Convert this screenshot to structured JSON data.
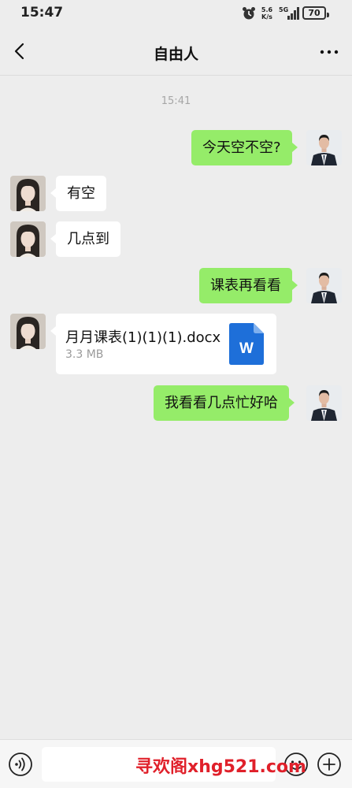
{
  "status_bar": {
    "time": "15:47",
    "net_speed_value": "5.6",
    "net_speed_unit": "K/s",
    "network_type": "5G",
    "battery": "70"
  },
  "header": {
    "title": "自由人",
    "back_icon": "chevron-left-icon",
    "more_icon": "more-dots-icon"
  },
  "chat": {
    "timestamp": "15:41",
    "messages": [
      {
        "side": "out",
        "text": "今天空不空?"
      },
      {
        "side": "in",
        "text": "有空"
      },
      {
        "side": "in",
        "text": "几点到"
      },
      {
        "side": "out",
        "text": "课表再看看"
      },
      {
        "side": "in",
        "type": "file",
        "file_name": "月月课表(1)(1)(1).docx",
        "file_size": "3.3 MB",
        "file_icon_letter": "W"
      },
      {
        "side": "out",
        "text": "我看看几点忙好哈"
      }
    ]
  },
  "input_bar": {
    "voice_icon": "voice-icon",
    "input_value": "",
    "emoji_icon": "emoji-icon",
    "plus_icon": "plus-icon"
  },
  "watermark": "寻欢阁xhg521.com",
  "colors": {
    "background": "#ededed",
    "outgoing_bubble": "#95ec69",
    "incoming_bubble": "#ffffff",
    "word_icon": "#1e6fd9",
    "watermark": "#e0202a"
  }
}
